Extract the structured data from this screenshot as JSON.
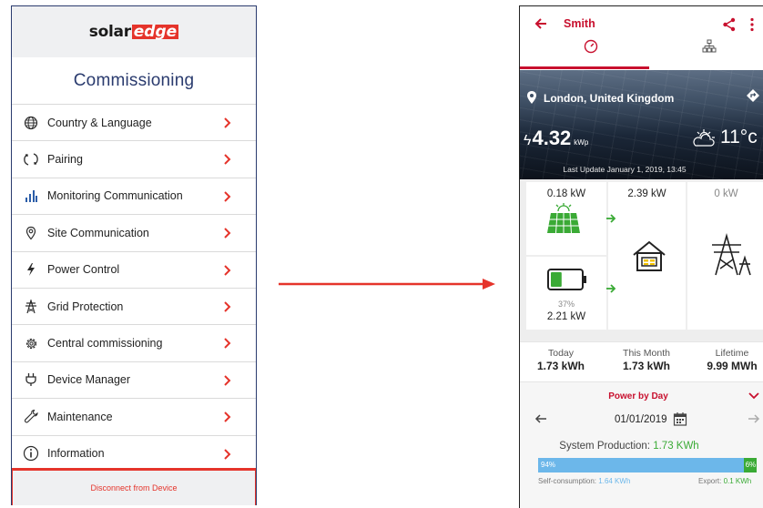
{
  "left_app": {
    "logo": {
      "part1": "solar",
      "part2": "edge"
    },
    "title": "Commissioning",
    "menu": [
      {
        "label": "Country & Language",
        "icon": "globe-icon"
      },
      {
        "label": "Pairing",
        "icon": "sync-icon"
      },
      {
        "label": "Monitoring Communication",
        "icon": "bar-chart-icon"
      },
      {
        "label": "Site Communication",
        "icon": "location-pin-icon"
      },
      {
        "label": "Power Control",
        "icon": "lightning-icon"
      },
      {
        "label": "Grid Protection",
        "icon": "power-tower-icon"
      },
      {
        "label": "Central commissioning",
        "icon": "gear-icon"
      },
      {
        "label": "Device Manager",
        "icon": "plug-icon"
      },
      {
        "label": "Maintenance",
        "icon": "wrench-icon"
      },
      {
        "label": "Information",
        "icon": "info-icon"
      }
    ],
    "disconnect": "Disconnect from Device"
  },
  "right_app": {
    "title": "Smith",
    "location": "London,  United Kingdom",
    "power": {
      "value": "4.32",
      "unit": "kWp"
    },
    "temperature": "11°c",
    "last_update": "Last Update January 1, 2019, 13:45",
    "flow": {
      "pv_power": "0.18 kW",
      "home_power": "2.39 kW",
      "grid_power": "0 kW",
      "battery_percent": "37%",
      "battery_power": "2.21 kW"
    },
    "stats": [
      {
        "label": "Today",
        "value": "1.73 kWh"
      },
      {
        "label": "This Month",
        "value": "1.73 kWh"
      },
      {
        "label": "Lifetime",
        "value": "9.99 MWh"
      }
    ],
    "power_by_day": {
      "title": "Power by Day",
      "date": "01/01/2019",
      "sys_prod_label": "System Production: ",
      "sys_prod_value": "1.73 KWh",
      "self_pct": "94%",
      "export_pct": "6%",
      "self_fraction": 0.94,
      "self_label": "Self-consumption: ",
      "self_value": "1.64 KWh",
      "export_label": "Export: ",
      "export_value": "0.1 KWh"
    }
  },
  "colors": {
    "brand_red": "#e5342b",
    "app_red": "#c8102e",
    "navy": "#2a3b6e",
    "green": "#3aaa35",
    "blue": "#6cb7ea"
  }
}
